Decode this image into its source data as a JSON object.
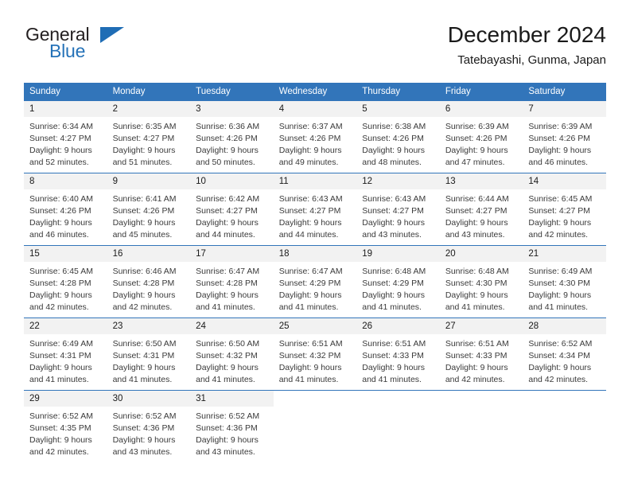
{
  "brand": {
    "name_part1": "General",
    "name_part2": "Blue",
    "logo_icon": "triangle-logo-icon"
  },
  "header": {
    "title": "December 2024",
    "subtitle": "Tatebayashi, Gunma, Japan"
  },
  "colors": {
    "header_blue": "#3275ba",
    "brand_blue": "#2572b8",
    "daynum_band": "#f2f2f2",
    "text": "#1a1a1a"
  },
  "weekday_headers": [
    "Sunday",
    "Monday",
    "Tuesday",
    "Wednesday",
    "Thursday",
    "Friday",
    "Saturday"
  ],
  "weeks": [
    [
      {
        "day": "1",
        "sunrise": "Sunrise: 6:34 AM",
        "sunset": "Sunset: 4:27 PM",
        "daylight1": "Daylight: 9 hours",
        "daylight2": "and 52 minutes."
      },
      {
        "day": "2",
        "sunrise": "Sunrise: 6:35 AM",
        "sunset": "Sunset: 4:27 PM",
        "daylight1": "Daylight: 9 hours",
        "daylight2": "and 51 minutes."
      },
      {
        "day": "3",
        "sunrise": "Sunrise: 6:36 AM",
        "sunset": "Sunset: 4:26 PM",
        "daylight1": "Daylight: 9 hours",
        "daylight2": "and 50 minutes."
      },
      {
        "day": "4",
        "sunrise": "Sunrise: 6:37 AM",
        "sunset": "Sunset: 4:26 PM",
        "daylight1": "Daylight: 9 hours",
        "daylight2": "and 49 minutes."
      },
      {
        "day": "5",
        "sunrise": "Sunrise: 6:38 AM",
        "sunset": "Sunset: 4:26 PM",
        "daylight1": "Daylight: 9 hours",
        "daylight2": "and 48 minutes."
      },
      {
        "day": "6",
        "sunrise": "Sunrise: 6:39 AM",
        "sunset": "Sunset: 4:26 PM",
        "daylight1": "Daylight: 9 hours",
        "daylight2": "and 47 minutes."
      },
      {
        "day": "7",
        "sunrise": "Sunrise: 6:39 AM",
        "sunset": "Sunset: 4:26 PM",
        "daylight1": "Daylight: 9 hours",
        "daylight2": "and 46 minutes."
      }
    ],
    [
      {
        "day": "8",
        "sunrise": "Sunrise: 6:40 AM",
        "sunset": "Sunset: 4:26 PM",
        "daylight1": "Daylight: 9 hours",
        "daylight2": "and 46 minutes."
      },
      {
        "day": "9",
        "sunrise": "Sunrise: 6:41 AM",
        "sunset": "Sunset: 4:26 PM",
        "daylight1": "Daylight: 9 hours",
        "daylight2": "and 45 minutes."
      },
      {
        "day": "10",
        "sunrise": "Sunrise: 6:42 AM",
        "sunset": "Sunset: 4:27 PM",
        "daylight1": "Daylight: 9 hours",
        "daylight2": "and 44 minutes."
      },
      {
        "day": "11",
        "sunrise": "Sunrise: 6:43 AM",
        "sunset": "Sunset: 4:27 PM",
        "daylight1": "Daylight: 9 hours",
        "daylight2": "and 44 minutes."
      },
      {
        "day": "12",
        "sunrise": "Sunrise: 6:43 AM",
        "sunset": "Sunset: 4:27 PM",
        "daylight1": "Daylight: 9 hours",
        "daylight2": "and 43 minutes."
      },
      {
        "day": "13",
        "sunrise": "Sunrise: 6:44 AM",
        "sunset": "Sunset: 4:27 PM",
        "daylight1": "Daylight: 9 hours",
        "daylight2": "and 43 minutes."
      },
      {
        "day": "14",
        "sunrise": "Sunrise: 6:45 AM",
        "sunset": "Sunset: 4:27 PM",
        "daylight1": "Daylight: 9 hours",
        "daylight2": "and 42 minutes."
      }
    ],
    [
      {
        "day": "15",
        "sunrise": "Sunrise: 6:45 AM",
        "sunset": "Sunset: 4:28 PM",
        "daylight1": "Daylight: 9 hours",
        "daylight2": "and 42 minutes."
      },
      {
        "day": "16",
        "sunrise": "Sunrise: 6:46 AM",
        "sunset": "Sunset: 4:28 PM",
        "daylight1": "Daylight: 9 hours",
        "daylight2": "and 42 minutes."
      },
      {
        "day": "17",
        "sunrise": "Sunrise: 6:47 AM",
        "sunset": "Sunset: 4:28 PM",
        "daylight1": "Daylight: 9 hours",
        "daylight2": "and 41 minutes."
      },
      {
        "day": "18",
        "sunrise": "Sunrise: 6:47 AM",
        "sunset": "Sunset: 4:29 PM",
        "daylight1": "Daylight: 9 hours",
        "daylight2": "and 41 minutes."
      },
      {
        "day": "19",
        "sunrise": "Sunrise: 6:48 AM",
        "sunset": "Sunset: 4:29 PM",
        "daylight1": "Daylight: 9 hours",
        "daylight2": "and 41 minutes."
      },
      {
        "day": "20",
        "sunrise": "Sunrise: 6:48 AM",
        "sunset": "Sunset: 4:30 PM",
        "daylight1": "Daylight: 9 hours",
        "daylight2": "and 41 minutes."
      },
      {
        "day": "21",
        "sunrise": "Sunrise: 6:49 AM",
        "sunset": "Sunset: 4:30 PM",
        "daylight1": "Daylight: 9 hours",
        "daylight2": "and 41 minutes."
      }
    ],
    [
      {
        "day": "22",
        "sunrise": "Sunrise: 6:49 AM",
        "sunset": "Sunset: 4:31 PM",
        "daylight1": "Daylight: 9 hours",
        "daylight2": "and 41 minutes."
      },
      {
        "day": "23",
        "sunrise": "Sunrise: 6:50 AM",
        "sunset": "Sunset: 4:31 PM",
        "daylight1": "Daylight: 9 hours",
        "daylight2": "and 41 minutes."
      },
      {
        "day": "24",
        "sunrise": "Sunrise: 6:50 AM",
        "sunset": "Sunset: 4:32 PM",
        "daylight1": "Daylight: 9 hours",
        "daylight2": "and 41 minutes."
      },
      {
        "day": "25",
        "sunrise": "Sunrise: 6:51 AM",
        "sunset": "Sunset: 4:32 PM",
        "daylight1": "Daylight: 9 hours",
        "daylight2": "and 41 minutes."
      },
      {
        "day": "26",
        "sunrise": "Sunrise: 6:51 AM",
        "sunset": "Sunset: 4:33 PM",
        "daylight1": "Daylight: 9 hours",
        "daylight2": "and 41 minutes."
      },
      {
        "day": "27",
        "sunrise": "Sunrise: 6:51 AM",
        "sunset": "Sunset: 4:33 PM",
        "daylight1": "Daylight: 9 hours",
        "daylight2": "and 42 minutes."
      },
      {
        "day": "28",
        "sunrise": "Sunrise: 6:52 AM",
        "sunset": "Sunset: 4:34 PM",
        "daylight1": "Daylight: 9 hours",
        "daylight2": "and 42 minutes."
      }
    ],
    [
      {
        "day": "29",
        "sunrise": "Sunrise: 6:52 AM",
        "sunset": "Sunset: 4:35 PM",
        "daylight1": "Daylight: 9 hours",
        "daylight2": "and 42 minutes."
      },
      {
        "day": "30",
        "sunrise": "Sunrise: 6:52 AM",
        "sunset": "Sunset: 4:36 PM",
        "daylight1": "Daylight: 9 hours",
        "daylight2": "and 43 minutes."
      },
      {
        "day": "31",
        "sunrise": "Sunrise: 6:52 AM",
        "sunset": "Sunset: 4:36 PM",
        "daylight1": "Daylight: 9 hours",
        "daylight2": "and 43 minutes."
      },
      {
        "day": "",
        "sunrise": "",
        "sunset": "",
        "daylight1": "",
        "daylight2": ""
      },
      {
        "day": "",
        "sunrise": "",
        "sunset": "",
        "daylight1": "",
        "daylight2": ""
      },
      {
        "day": "",
        "sunrise": "",
        "sunset": "",
        "daylight1": "",
        "daylight2": ""
      },
      {
        "day": "",
        "sunrise": "",
        "sunset": "",
        "daylight1": "",
        "daylight2": ""
      }
    ]
  ]
}
